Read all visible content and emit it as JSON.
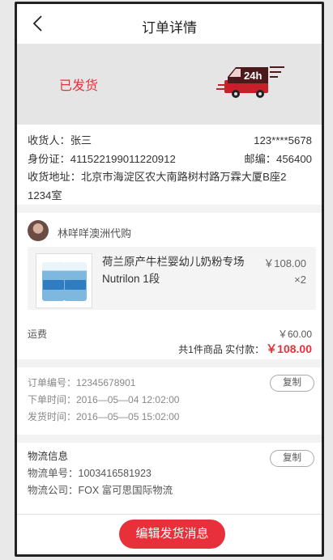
{
  "header": {
    "title": "订单详情"
  },
  "status": {
    "text": "已发货",
    "truck_badge": "24h",
    "accent": "#e8303a"
  },
  "address": {
    "receiver_label": "收货人：",
    "receiver_name": "张三",
    "phone": "123****5678",
    "id_label": "身份证：",
    "id_number": "411522199011220912",
    "zip_label": "邮编：",
    "zip": "456400",
    "addr_label": "收货地址：",
    "addr_line1": "北京市海淀区农大南路树村路万霖大厦B座2",
    "addr_line2": "1234室"
  },
  "shop": {
    "name": "林咩咩澳洲代购"
  },
  "product": {
    "name": "荷兰原产牛栏婴幼儿奶粉专场Nutrilon 1段",
    "price": "￥108.00",
    "qty": "×2",
    "icon": "milk-powder-can"
  },
  "fees": {
    "shipping_label": "运费",
    "shipping": "￥60.00",
    "summary": "共1件商品  实付款：",
    "total": "￥108.00"
  },
  "order_info": {
    "copy_label": "复制",
    "order_no": "订单编号：12345678901",
    "order_time": "下单时间：2016—05—04 12:02:00",
    "ship_time": "发货时间：2016—05—05 15:02:00"
  },
  "logistics": {
    "title": "物流信息",
    "copy_label": "复制",
    "tracking": "物流单号：1003416581923",
    "company": "物流公司：FOX 富可思国际物流"
  },
  "actions": {
    "edit_label": "编辑发货消息"
  }
}
